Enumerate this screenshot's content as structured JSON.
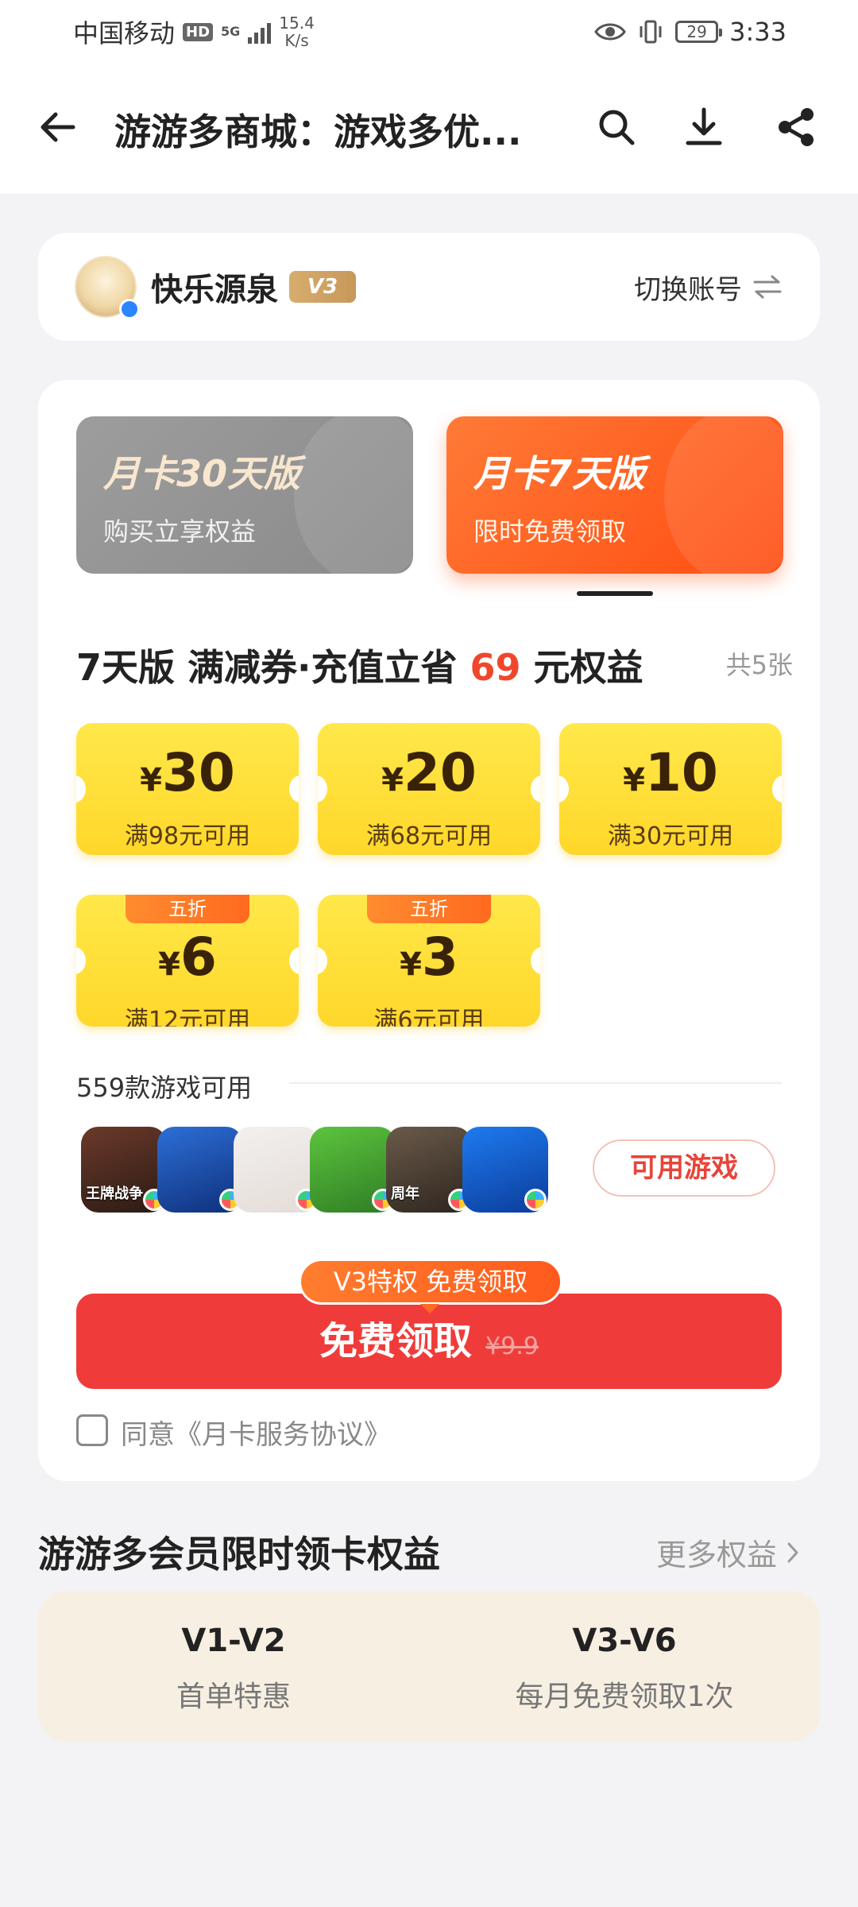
{
  "status_bar": {
    "carrier": "中国移动",
    "hd": "HD",
    "net_type": "5G",
    "speed_value": "15.4",
    "speed_unit": "K/s",
    "battery": "29",
    "time": "3:33"
  },
  "header": {
    "title": "游游多商城：游戏多优..."
  },
  "user": {
    "name": "快乐源泉",
    "level": "V3",
    "switch_label": "切换账号"
  },
  "plans": [
    {
      "title": "月卡30天版",
      "subtitle": "购买立享权益",
      "selected": false
    },
    {
      "title": "月卡7天版",
      "subtitle": "限时免费领取",
      "selected": true
    }
  ],
  "coupons_section": {
    "heading_prefix": "7天版 满减券·充值立省",
    "heading_value": "69",
    "heading_suffix": "元权益",
    "count": "共5张"
  },
  "coupons": [
    {
      "amount": "30",
      "condition": "满98元可用",
      "tag": ""
    },
    {
      "amount": "20",
      "condition": "满68元可用",
      "tag": ""
    },
    {
      "amount": "10",
      "condition": "满30元可用",
      "tag": ""
    },
    {
      "amount": "6",
      "condition": "满12元可用",
      "tag": "五折"
    },
    {
      "amount": "3",
      "condition": "满6元可用",
      "tag": "五折"
    }
  ],
  "currency_symbol": "¥",
  "games": {
    "label": "559款游戏可用",
    "icons": [
      {
        "name": "王牌战争",
        "colors": [
          "#6b3a2a",
          "#2a1a14"
        ]
      },
      {
        "name": "",
        "colors": [
          "#2d6fd6",
          "#0e2f7a"
        ]
      },
      {
        "name": "",
        "colors": [
          "#f3f0ee",
          "#e4dcd8"
        ]
      },
      {
        "name": "",
        "colors": [
          "#5cc43e",
          "#2f7d24"
        ]
      },
      {
        "name": "周年",
        "colors": [
          "#6a5a4a",
          "#2e251e"
        ]
      },
      {
        "name": "",
        "colors": [
          "#1e7bf0",
          "#0b3c9a"
        ]
      }
    ],
    "available_button": "可用游戏"
  },
  "claim": {
    "bubble": "V3特权 免费领取",
    "button": "免费领取",
    "original_price": "¥9.9",
    "agreement": "同意《月卡服务协议》"
  },
  "benefits": {
    "title": "游游多会员限时领卡权益",
    "more": "更多权益",
    "tiers": [
      {
        "tier": "V1-V2",
        "desc": "首单特惠"
      },
      {
        "tier": "V3-V6",
        "desc": "每月免费领取1次"
      }
    ]
  },
  "colors": {
    "accent_red": "#ef3c3a",
    "accent_orange": "#ff5a1c",
    "coupon_yellow": "#ffd72a"
  }
}
